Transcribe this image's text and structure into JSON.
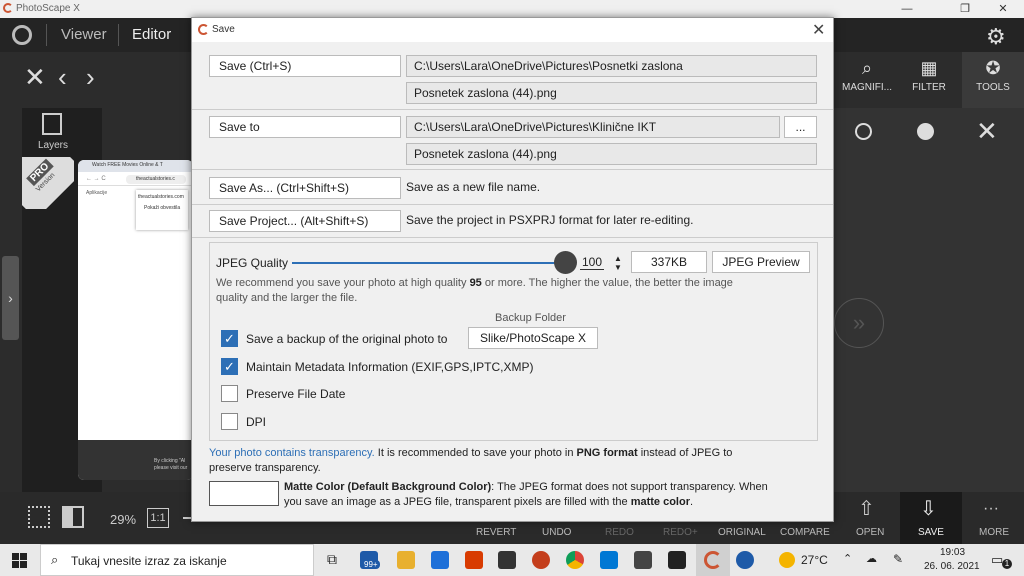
{
  "app": {
    "title": "PhotoScape X",
    "nav": [
      "Viewer",
      "Editor"
    ],
    "tools": [
      {
        "icon": "magnifier-icon",
        "label": "MAGNIFI..."
      },
      {
        "icon": "filter-icon",
        "label": "FILTER"
      },
      {
        "icon": "tools-icon",
        "label": "TOOLS"
      }
    ],
    "layers_label": "Layers",
    "pro_badge": "PRO",
    "pro_sub": "Version",
    "zoom": "29%",
    "zoom_fit": "1:1",
    "bottom_actions": [
      "REVERT",
      "UNDO",
      "REDO",
      "REDO+",
      "ORIGINAL",
      "COMPARE"
    ],
    "bottom_right": [
      "OPEN",
      "SAVE",
      "MORE"
    ],
    "canvas_preview": {
      "tab": "Watch FREE Movies Online & T",
      "address": "theactualstories.c",
      "apps": "Aplikacije",
      "site": "theactualstories.com",
      "notify": "Pokaži obvestila",
      "footer1": "By clicking \"Al",
      "footer2": "please visit our"
    }
  },
  "dialog": {
    "title": "Save",
    "save": {
      "button": "Save   (Ctrl+S)",
      "path": "C:\\Users\\Lara\\OneDrive\\Pictures\\Posnetki zaslona",
      "file": "Posnetek zaslona (44).png"
    },
    "save_to": {
      "button": "Save to",
      "path": "C:\\Users\\Lara\\OneDrive\\Pictures\\Klinične IKT",
      "browse": "...",
      "file": "Posnetek zaslona (44).png"
    },
    "save_as": {
      "button": "Save As...   (Ctrl+Shift+S)",
      "desc": "Save as a new file name."
    },
    "save_project": {
      "button": "Save Project...   (Alt+Shift+S)",
      "desc": "Save the project in PSXPRJ format for later re-editing."
    },
    "jpeg": {
      "label": "JPEG Quality",
      "quality": 100,
      "quality_text": "100",
      "size": "337KB",
      "preview_button": "JPEG Preview",
      "recommend_a": "We recommend you save your photo at high quality ",
      "recommend_bold": "95",
      "recommend_b": " or more. The higher the value, the better the image",
      "recommend_c": "quality and the larger the file.",
      "backup_folder_label": "Backup Folder",
      "backup_folder": "Slike/PhotoScape X",
      "options": [
        {
          "label": "Save a backup of the original photo to",
          "checked": true
        },
        {
          "label": "Maintain Metadata Information (EXIF,GPS,IPTC,XMP)",
          "checked": true
        },
        {
          "label": "Preserve File Date",
          "checked": false
        },
        {
          "label": "DPI",
          "checked": false
        }
      ]
    },
    "transparency": {
      "link": "Your photo contains transparency.",
      "text_a": " It is recommended to save your photo in ",
      "bold": "PNG format",
      "text_b": " instead of JPEG to",
      "text_c": "preserve transparency."
    },
    "matte": {
      "bold": "Matte Color (Default Background Color)",
      "text_a": ": The JPEG format does not support transparency. When",
      "text_b": "you save an image as a JPEG file, transparent pixels are filled with the ",
      "bold2": "matte color",
      "text_c": "."
    }
  },
  "taskbar": {
    "search_placeholder": "Tukaj vnesite izraz za iskanje",
    "badge": "99+",
    "weather": "27°C",
    "time": "19:03",
    "date": "26. 06. 2021",
    "notifications": "1"
  },
  "colors": {
    "accent": "#2d6fb6",
    "app_bg": "#2c2c2c",
    "dialog_bg": "#f0f0f0"
  }
}
